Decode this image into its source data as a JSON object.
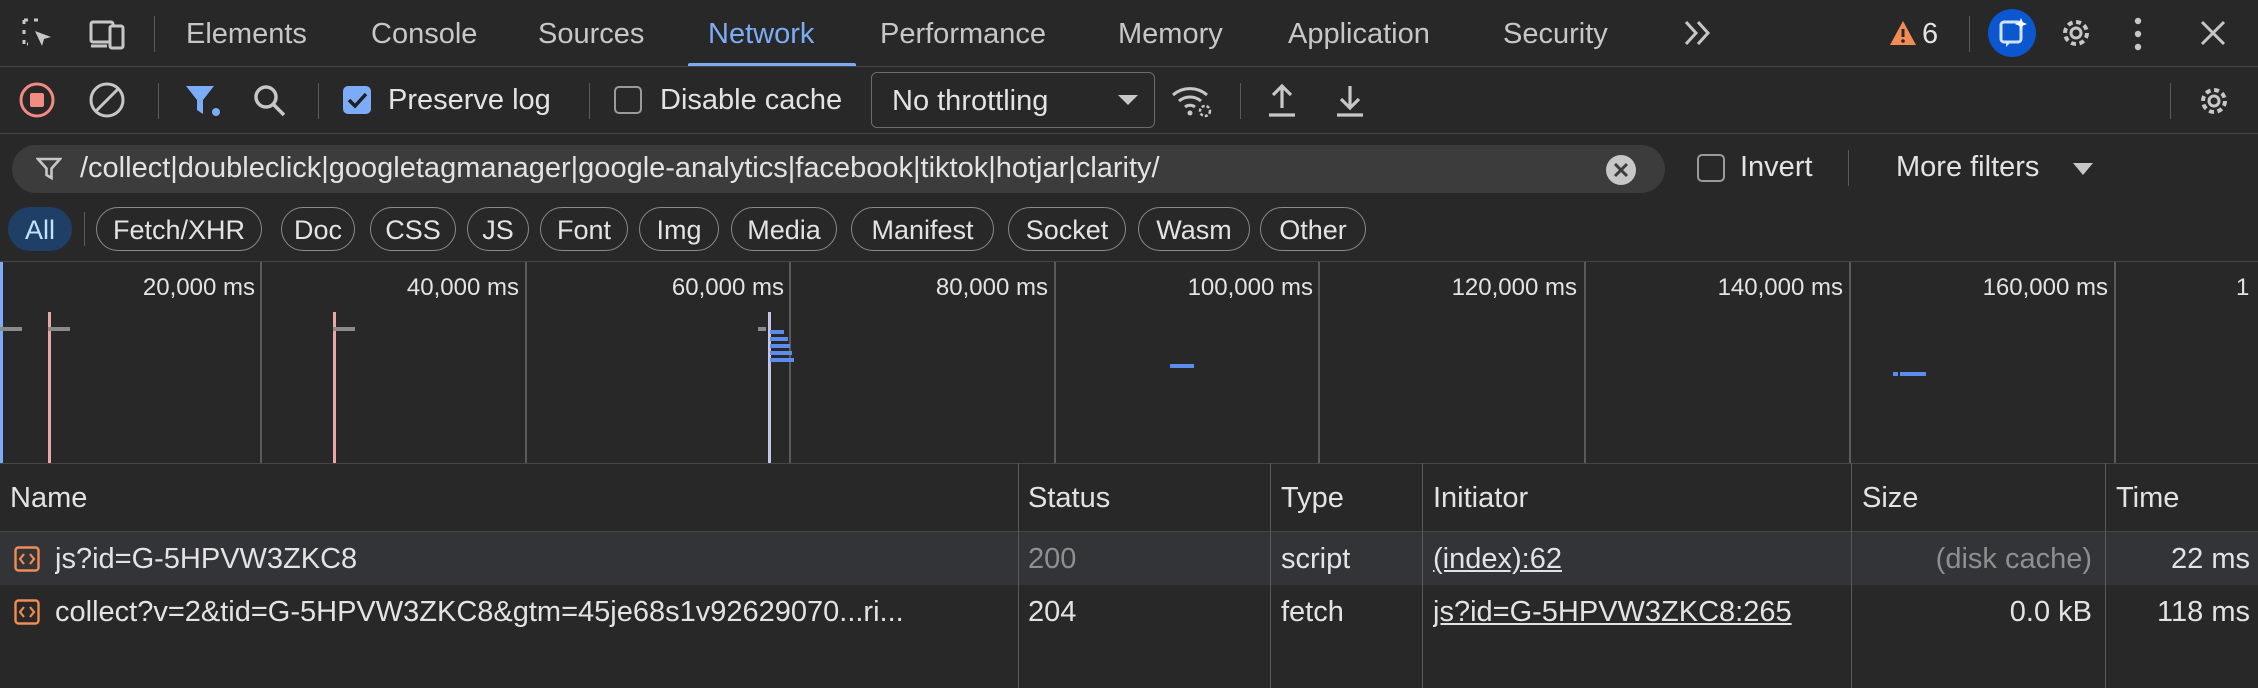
{
  "tabs": {
    "items": [
      "Elements",
      "Console",
      "Sources",
      "Network",
      "Performance",
      "Memory",
      "Application",
      "Security"
    ],
    "active": "Network",
    "more_icon": "chevron-double-right-icon",
    "warning_count": "6"
  },
  "toolbar": {
    "preserve_log_label": "Preserve log",
    "preserve_log_checked": true,
    "disable_cache_label": "Disable cache",
    "disable_cache_checked": false,
    "throttling_value": "No throttling"
  },
  "filter": {
    "value": "/collect|doubleclick|googletagmanager|google-analytics|facebook|tiktok|hotjar|clarity/",
    "invert_label": "Invert",
    "invert_checked": false,
    "more_filters_label": "More filters"
  },
  "type_filters": [
    "All",
    "Fetch/XHR",
    "Doc",
    "CSS",
    "JS",
    "Font",
    "Img",
    "Media",
    "Manifest",
    "Socket",
    "Wasm",
    "Other"
  ],
  "overview": {
    "ticks": [
      "20,000 ms",
      "40,000 ms",
      "60,000 ms",
      "80,000 ms",
      "100,000 ms",
      "120,000 ms",
      "140,000 ms",
      "160,000 ms",
      "1"
    ]
  },
  "table": {
    "headers": {
      "name": "Name",
      "status": "Status",
      "type": "Type",
      "initiator": "Initiator",
      "size": "Size",
      "time": "Time"
    },
    "rows": [
      {
        "name": "js?id=G-5HPVW3ZKC8",
        "status": "200",
        "type": "script",
        "initiator": "(index):62",
        "size": "(disk cache)",
        "time": "22 ms"
      },
      {
        "name": "collect?v=2&tid=G-5HPVW3ZKC8&gtm=45je68s1v92629070...ri...",
        "status": "204",
        "type": "fetch",
        "initiator": "js?id=G-5HPVW3ZKC8:265",
        "size": "0.0 kB",
        "time": "118 ms"
      }
    ]
  },
  "colors": {
    "accent": "#7cacf8",
    "warning": "#f28b54",
    "record": "#f28b82",
    "ai_button": "#0b57d0"
  }
}
